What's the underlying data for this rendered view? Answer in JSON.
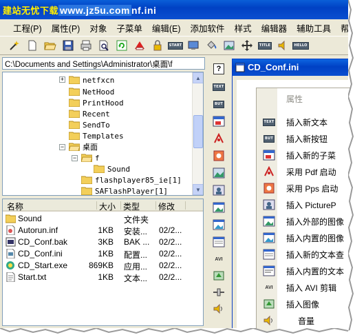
{
  "title_bar": {
    "watermark_label": "建站无忧下载",
    "watermark_url": "www.jz5u.com",
    "title_suffix": "nf.ini"
  },
  "menu": [
    "工程(P)",
    "属性(P)",
    "对象",
    "子菜单",
    "编辑(E)",
    "添加软件",
    "样式",
    "编辑器",
    "辅助工具",
    "帮"
  ],
  "toolbar": {
    "icons": [
      "wand-icon",
      "new-file-icon",
      "open-folder-icon",
      "save-icon",
      "print-icon",
      "print-preview-icon",
      "refresh-icon",
      "bookmark-icon",
      "lock-icon",
      "start-icon",
      "monitor-icon",
      "paint-bucket-icon",
      "picture-icon",
      "move-icon",
      "title-icon",
      "speaker-icon",
      "hello-icon"
    ],
    "start_label": "START",
    "title_label": "TITLE",
    "hello_label": "HELLO"
  },
  "path_bar": {
    "value": "C:\\Documents and Settings\\Administrator\\桌面\\f"
  },
  "tree": {
    "items": [
      {
        "label": "netfxcn",
        "expander": "+"
      },
      {
        "label": "NetHood"
      },
      {
        "label": "PrintHood"
      },
      {
        "label": "Recent"
      },
      {
        "label": "SendTo"
      },
      {
        "label": "Templates"
      },
      {
        "label": "桌面",
        "expander": "−"
      },
      {
        "label": "f",
        "expander": "−"
      },
      {
        "label": "Sound"
      },
      {
        "label": "flashplayer85_ie[1]"
      },
      {
        "label": "SAFlashPlayer[1]"
      }
    ]
  },
  "file_list": {
    "headers": {
      "name": "名称",
      "size": "大小",
      "type": "类型",
      "modified": "修改"
    },
    "rows": [
      {
        "name": "Sound",
        "size": "",
        "type": "文件夹",
        "modified": "",
        "icon": "folder-icon"
      },
      {
        "name": "Autorun.inf",
        "size": "1KB",
        "type": "安装...",
        "modified": "02/2...",
        "icon": "inf-file-icon"
      },
      {
        "name": "CD_Conf.bak",
        "size": "3KB",
        "type": "BAK ...",
        "modified": "02/2...",
        "icon": "bak-file-icon"
      },
      {
        "name": "CD_Conf.ini",
        "size": "1KB",
        "type": "配置...",
        "modified": "02/2...",
        "icon": "ini-file-icon"
      },
      {
        "name": "CD_Start.exe",
        "size": "869KB",
        "type": "应用...",
        "modified": "02/2...",
        "icon": "exe-file-icon"
      },
      {
        "name": "Start.txt",
        "size": "1KB",
        "type": "文本...",
        "modified": "02/2...",
        "icon": "txt-file-icon"
      }
    ]
  },
  "palette": {
    "labels": {
      "help": "?",
      "text": "TEXT",
      "but": "BUT",
      "avi": "AVI"
    }
  },
  "inner_window": {
    "title": "CD_Conf.ini"
  },
  "context_menu": {
    "items": [
      {
        "label": "属性",
        "disabled": true,
        "icon": ""
      },
      {
        "label": "插入新文本",
        "icon": "text-icon",
        "badge": "TEXT"
      },
      {
        "label": "插入新按钮",
        "icon": "button-icon",
        "badge": "BUT"
      },
      {
        "label": "插入新的子菜",
        "icon": "submenu-icon"
      },
      {
        "label": "采用 Pdf 启动",
        "icon": "pdf-icon"
      },
      {
        "label": "采用 Pps 启动",
        "icon": "pps-icon"
      },
      {
        "label": "插入 PictureP",
        "icon": "picture-icon"
      },
      {
        "label": "插入外部的图像",
        "icon": "external-image-icon"
      },
      {
        "label": "插入内置的图像",
        "icon": "internal-image-icon"
      },
      {
        "label": "插入新的文本查",
        "icon": "text-viewer-icon"
      },
      {
        "label": "插入内置的文本",
        "icon": "internal-text-icon"
      },
      {
        "label": "插入 AVI 剪辑",
        "icon": "avi-icon",
        "badge": "AVI"
      },
      {
        "label": "插入图像",
        "icon": "image-icon"
      },
      {
        "label": "音量",
        "icon": "volume-icon"
      }
    ]
  },
  "colors": {
    "title_blue": "#0041c4",
    "chrome": "#ece9d8",
    "watermark_yellow": "#ffee00",
    "folder_yellow": "#f3cf5a"
  }
}
